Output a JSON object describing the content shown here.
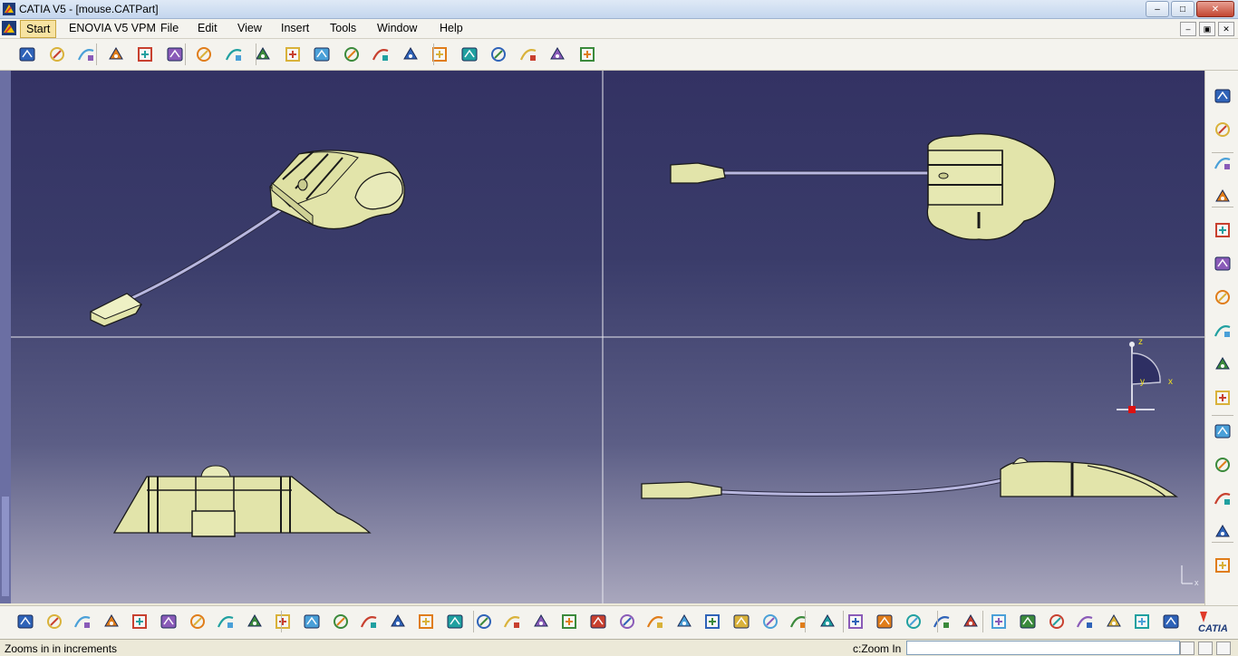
{
  "window": {
    "title": "CATIA V5 - [mouse.CATPart]",
    "controls": {
      "minimize": "–",
      "maximize": "□",
      "close": "✕"
    }
  },
  "menu": {
    "items": [
      "Start",
      "ENOVIA V5 VPM",
      "File",
      "Edit",
      "View",
      "Insert",
      "Tools",
      "Window",
      "Help"
    ],
    "doc_controls": {
      "minimize": "–",
      "restore": "▣",
      "close": "✕"
    }
  },
  "toolbars": {
    "top_icons": [
      "point-icon",
      "line-icon",
      "plane-icon",
      "extrude-surface-icon",
      "revolve-surface-icon",
      "sweep-icon",
      "circle-icon",
      "spline-icon",
      "offset-icon",
      "fill-icon",
      "blend-icon",
      "multisection-icon",
      "loft-icon",
      "surface-icon",
      "join-icon",
      "split-icon",
      "trim-icon",
      "fillet-icon",
      "translate-icon",
      "analysis-icon"
    ],
    "right_icons": [
      "select-icon",
      "compass-icon",
      "sketch-icon",
      "curve-icon",
      "repetition-icon",
      "pattern-icon",
      "body-icon",
      "insert-body-icon",
      "boolean-icon",
      "tools-icon",
      "measure-icon",
      "apply-material-icon",
      "render-icon",
      "snap-icon",
      "update-icon"
    ],
    "bottom_icons": [
      "new-icon",
      "open-icon",
      "save-icon",
      "print-icon",
      "cut-icon",
      "copy-icon",
      "paste-icon",
      "undo-icon",
      "redo-icon",
      "whats-this-icon",
      "formula-icon",
      "comment-icon",
      "knowledge-icon",
      "table-icon",
      "tree-icon",
      "lock-icon",
      "catalog-icon",
      "fly-mode-icon",
      "fit-all-icon",
      "pan-icon",
      "rotate-icon",
      "zoom-in-icon",
      "zoom-out-icon",
      "normal-view-icon",
      "shading-icon",
      "iso-view-icon",
      "view-mode-icon",
      "render-style-icon",
      "hide-show-icon",
      "swap-icon",
      "measure-between-icon",
      "measure-item-icon",
      "inertia-icon",
      "capture-icon",
      "cycle-icon",
      "hand-icon",
      "axis-icon",
      "grid-icon",
      "table-grid-icon",
      "layer-icon",
      "cube-icon"
    ]
  },
  "viewport": {
    "compass_axes": [
      "z",
      "y",
      "x"
    ],
    "small_axis_label": "x",
    "colors": {
      "model_fill": "#e2e4aa",
      "model_stroke": "#1a1a1a",
      "cable": "#b9b8e0",
      "background_top": "#333263",
      "background_bottom": "#a9a7bd"
    }
  },
  "status": {
    "message": "Zooms in in increments",
    "command_label": "c:Zoom In",
    "command_value": ""
  },
  "brand": {
    "logo_text": "CATIA"
  }
}
